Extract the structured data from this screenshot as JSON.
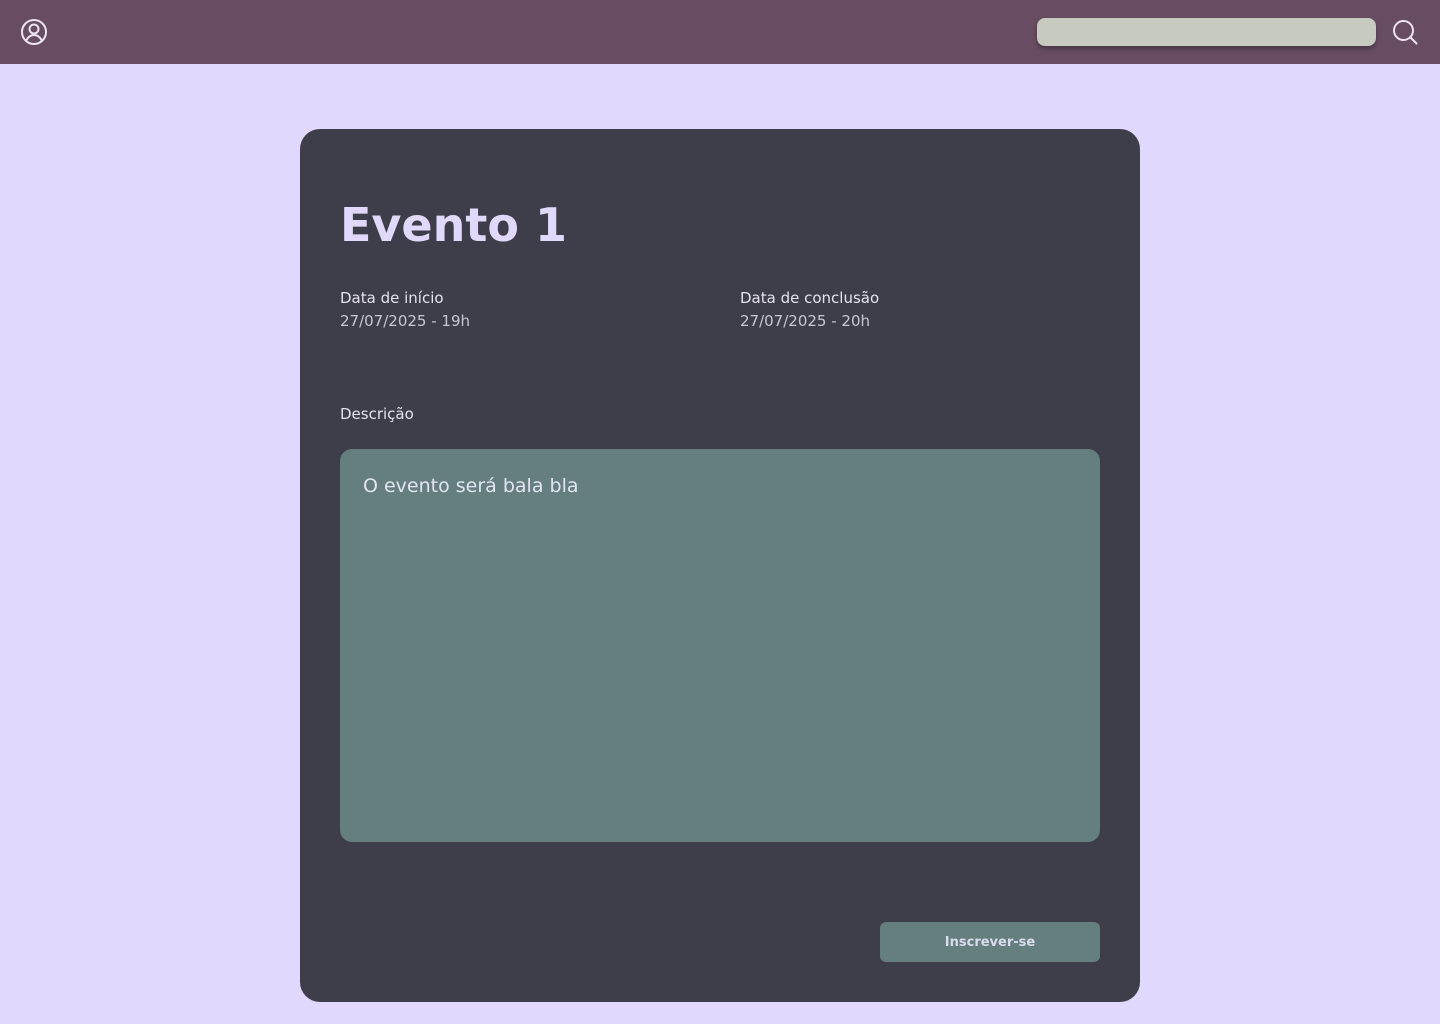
{
  "colors": {
    "page_background": "#e0d8fd",
    "topbar_background": "#674c62",
    "card_background": "#3e3d4a",
    "accent": "#657e7e",
    "search_field": "#c6cabf"
  },
  "header": {
    "profile_icon": "user-circle-icon",
    "search": {
      "placeholder": "",
      "value": "",
      "icon": "search-icon"
    }
  },
  "event": {
    "title": "Evento 1",
    "start": {
      "label": "Data de início",
      "value": "27/07/2025 - 19h"
    },
    "end": {
      "label": "Data de conclusão",
      "value": "27/07/2025 - 20h"
    },
    "description": {
      "label": "Descrição",
      "text": "O evento será bala bla"
    },
    "subscribe_label": "Inscrever-se"
  }
}
